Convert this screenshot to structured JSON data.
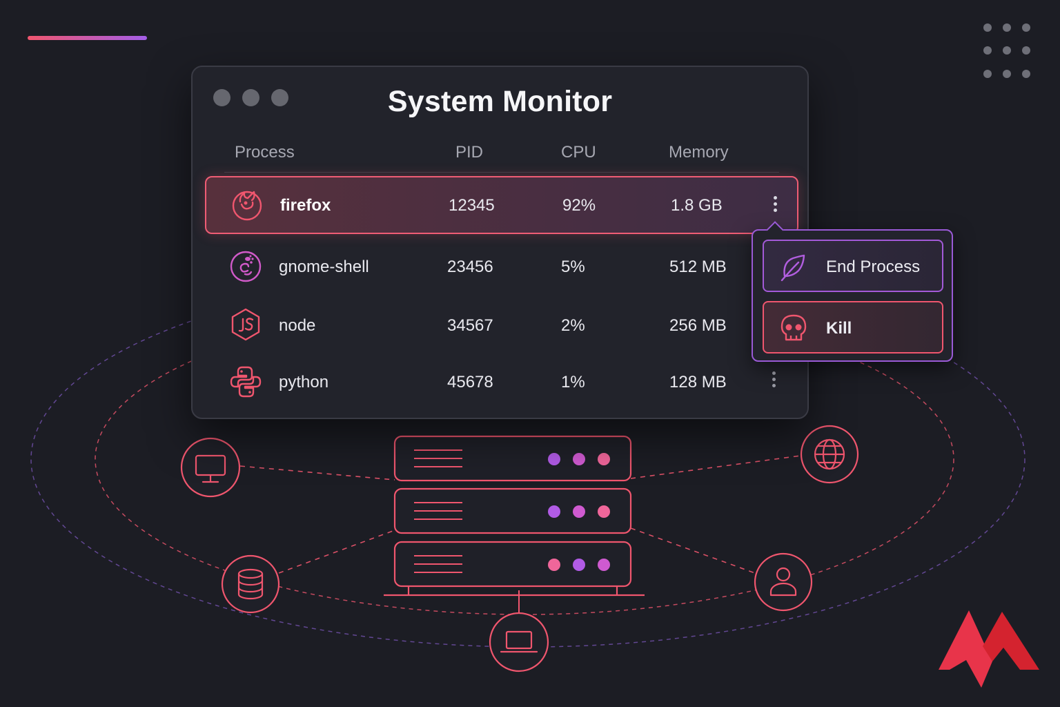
{
  "window": {
    "title": "System Monitor",
    "columns": [
      "Process",
      "PID",
      "CPU",
      "Memory"
    ]
  },
  "processes": [
    {
      "icon": "firefox-icon",
      "name": "firefox",
      "pid": "12345",
      "cpu": "92%",
      "memory": "1.8 GB",
      "selected": true
    },
    {
      "icon": "gnome-icon",
      "name": "gnome-shell",
      "pid": "23456",
      "cpu": "5%",
      "memory": "512 MB",
      "selected": false
    },
    {
      "icon": "nodejs-icon",
      "name": "node",
      "pid": "34567",
      "cpu": "2%",
      "memory": "256 MB",
      "selected": false
    },
    {
      "icon": "python-icon",
      "name": "python",
      "pid": "45678",
      "cpu": "1%",
      "memory": "128 MB",
      "selected": false
    }
  ],
  "context_menu": {
    "items": [
      {
        "icon": "leaf-icon",
        "label": "End Process"
      },
      {
        "icon": "skull-icon",
        "label": "Kill"
      }
    ]
  },
  "illustration": {
    "server_units": 3,
    "nodes": [
      "monitor-icon",
      "database-icon",
      "laptop-icon",
      "globe-icon",
      "user-icon"
    ]
  },
  "colors": {
    "background": "#1c1d24",
    "accent_pink": "#f0566e",
    "accent_purple": "#a35ee8",
    "brand_red": "#e8344a"
  }
}
